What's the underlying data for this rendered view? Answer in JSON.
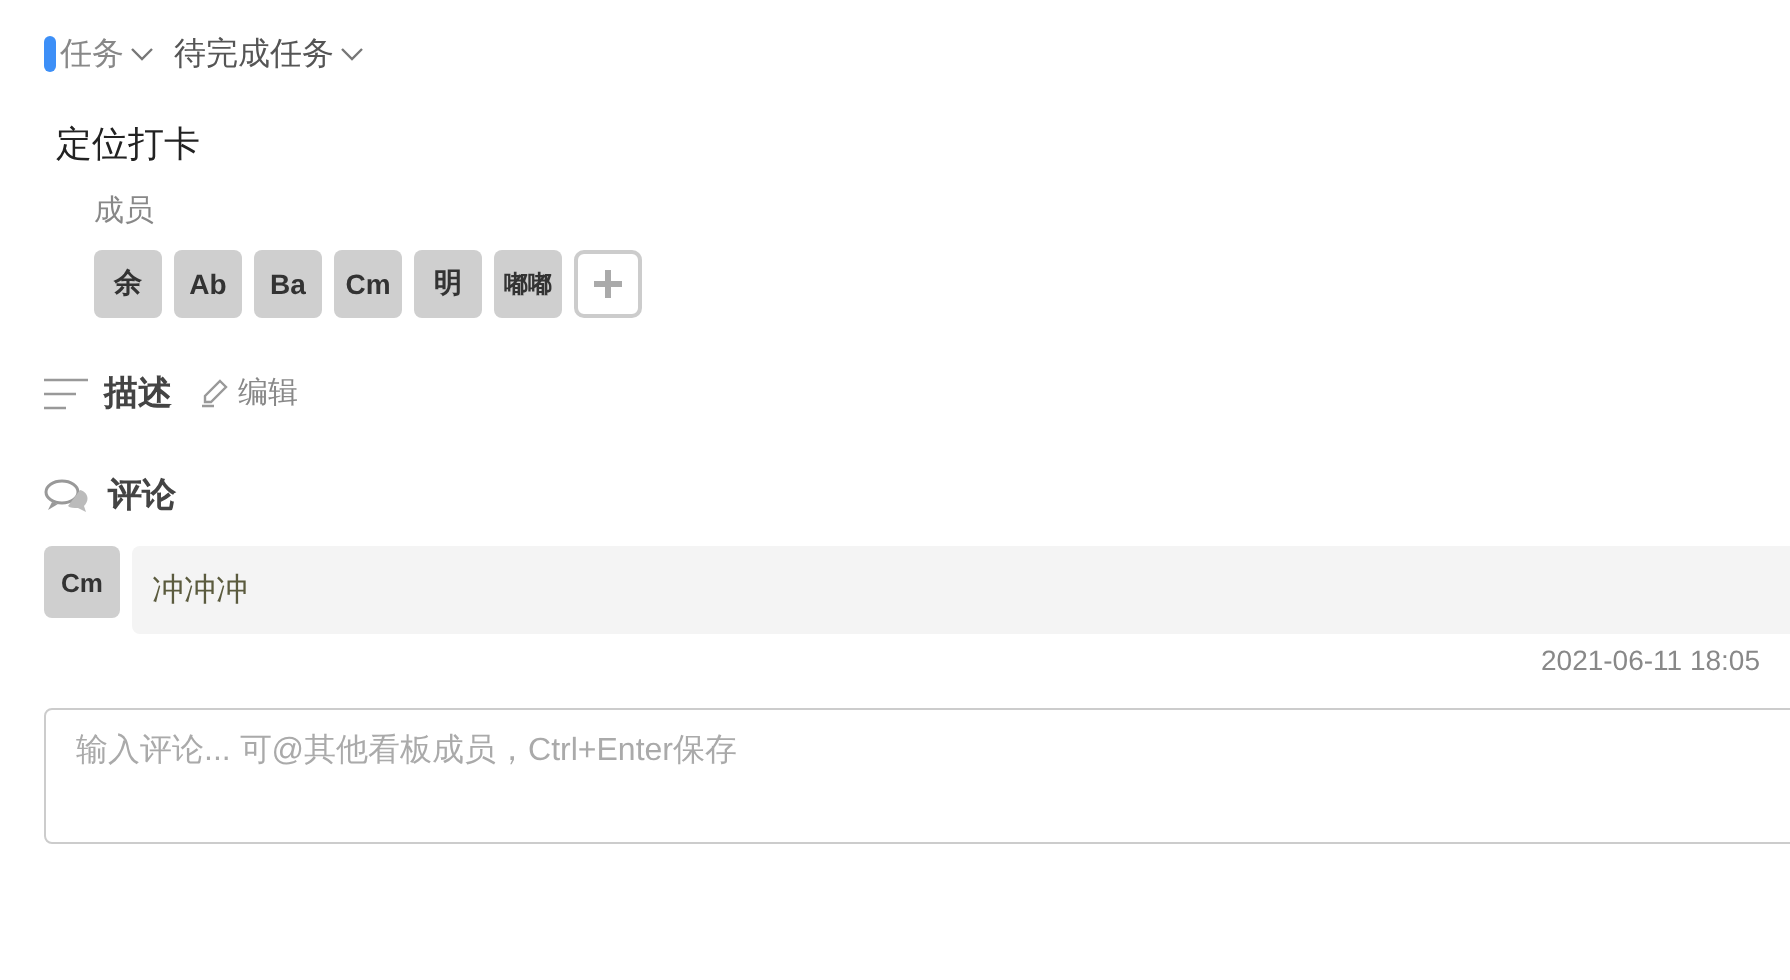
{
  "breadcrumb": [
    {
      "label": "任务"
    },
    {
      "label": "待完成任务"
    }
  ],
  "task": {
    "title": "定位打卡"
  },
  "members": {
    "label": "成员",
    "avatars": [
      "余",
      "Ab",
      "Ba",
      "Cm",
      "明",
      "嘟嘟"
    ]
  },
  "description": {
    "label": "描述",
    "edit": "编辑"
  },
  "comments": {
    "label": "评论",
    "items": [
      {
        "avatar": "Cm",
        "text": "冲冲冲",
        "time": "2021-06-11 18:05"
      }
    ],
    "input": {
      "placeholder": "输入评论... 可@其他看板成员，Ctrl+Enter保存"
    }
  }
}
